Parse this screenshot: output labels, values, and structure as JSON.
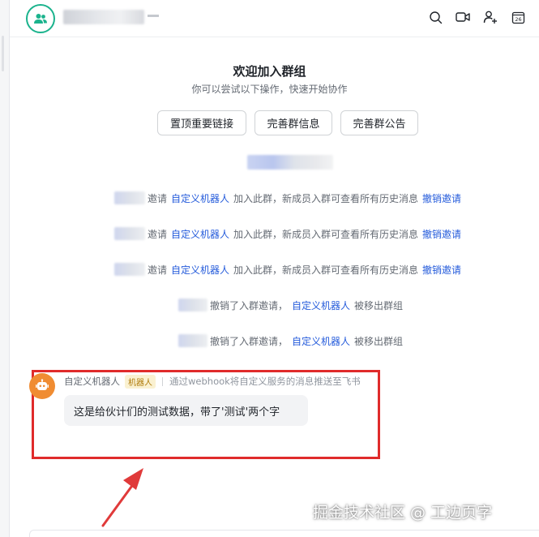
{
  "welcome": {
    "title": "欢迎加入群组",
    "subtitle": "你可以尝试以下操作，快速开始协作"
  },
  "actions": {
    "pin_links": "置顶重要链接",
    "complete_info": "完善群信息",
    "complete_notice": "完善群公告"
  },
  "system_messages": [
    {
      "verb": "邀请",
      "target": "自定义机器人",
      "text": "加入此群，新成员入群可查看所有历史消息",
      "action": "撤销邀请"
    },
    {
      "verb": "邀请",
      "target": "自定义机器人",
      "text": "加入此群，新成员入群可查看所有历史消息",
      "action": "撤销邀请"
    },
    {
      "verb": "邀请",
      "target": "自定义机器人",
      "text": "加入此群，新成员入群可查看所有历史消息",
      "action": "撤销邀请"
    },
    {
      "verb": "撤销了入群邀请，",
      "target": "自定义机器人",
      "text": "被移出群组"
    },
    {
      "verb": "撤销了入群邀请，",
      "target": "自定义机器人",
      "text": "被移出群组"
    }
  ],
  "message": {
    "sender": "自定义机器人",
    "tag": "机器人",
    "description": "通过webhook将自定义服务的消息推送至飞书",
    "content": "这是给伙计们的测试数据，带了'测试'两个字"
  },
  "watermark": "掘金技术社区 @ 工边页字",
  "calendar_day": "26",
  "colors": {
    "link": "#245bdb",
    "highlight": "#e02b2b",
    "group_avatar": "#1bb38d",
    "bot_avatar": "#f08c32"
  },
  "icons": [
    "group-icon",
    "search-icon",
    "video-icon",
    "add-member-icon",
    "calendar-icon",
    "robot-icon"
  ]
}
